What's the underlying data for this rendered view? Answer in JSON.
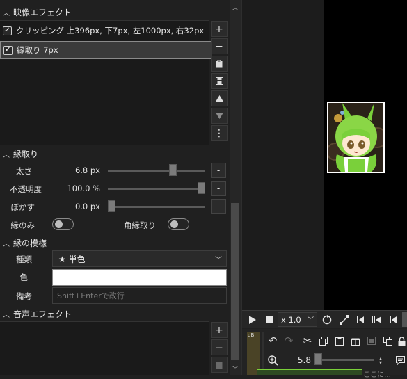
{
  "video_effects": {
    "title": "映像エフェクト",
    "items": [
      {
        "label": "クリッピング 上396px, 下7px, 左1000px, 右32px",
        "checked": true,
        "selected": false
      },
      {
        "label": "縁取り 7px",
        "checked": true,
        "selected": true
      }
    ],
    "side_buttons": [
      {
        "name": "add",
        "glyph": "+"
      },
      {
        "name": "remove",
        "glyph": "−"
      },
      {
        "name": "copy",
        "glyph": "▣"
      },
      {
        "name": "save",
        "glyph": "▤"
      },
      {
        "name": "move-up",
        "glyph": "▲"
      },
      {
        "name": "move-down",
        "glyph": "▼"
      },
      {
        "name": "more",
        "glyph": "⋮"
      }
    ]
  },
  "border": {
    "title": "縁取り",
    "rows": [
      {
        "label": "太さ",
        "value": "6.8 px",
        "position": 0.68,
        "button": "-"
      },
      {
        "label": "不透明度",
        "value": "100.0 %",
        "position": 1.0,
        "button": "-"
      },
      {
        "label": "ぼかす",
        "value": "0.0 px",
        "position": 0.0,
        "button": "-"
      }
    ],
    "toggles": [
      {
        "label": "縁のみ",
        "on": false
      },
      {
        "label": "角縁取り",
        "on": false
      }
    ]
  },
  "border_pattern": {
    "title": "縁の模様",
    "type_label": "種類",
    "type_value": "★ 単色",
    "color_label": "色",
    "color_value": "#ffffff",
    "note_label": "備考",
    "note_placeholder": "Shift+Enterで改行"
  },
  "audio_effects": {
    "title": "音声エフェクト",
    "side_buttons": [
      {
        "name": "add",
        "glyph": "+"
      },
      {
        "name": "remove",
        "glyph": "−"
      },
      {
        "name": "copy",
        "glyph": "▣"
      }
    ]
  },
  "player": {
    "speed": "x 1.0",
    "zoom": "5.8",
    "clip_bottom_text": "ここに…"
  },
  "colors": {
    "panel_bg": "#202020",
    "preview_bg": "#000000",
    "accent_green": "#7ad03a"
  }
}
